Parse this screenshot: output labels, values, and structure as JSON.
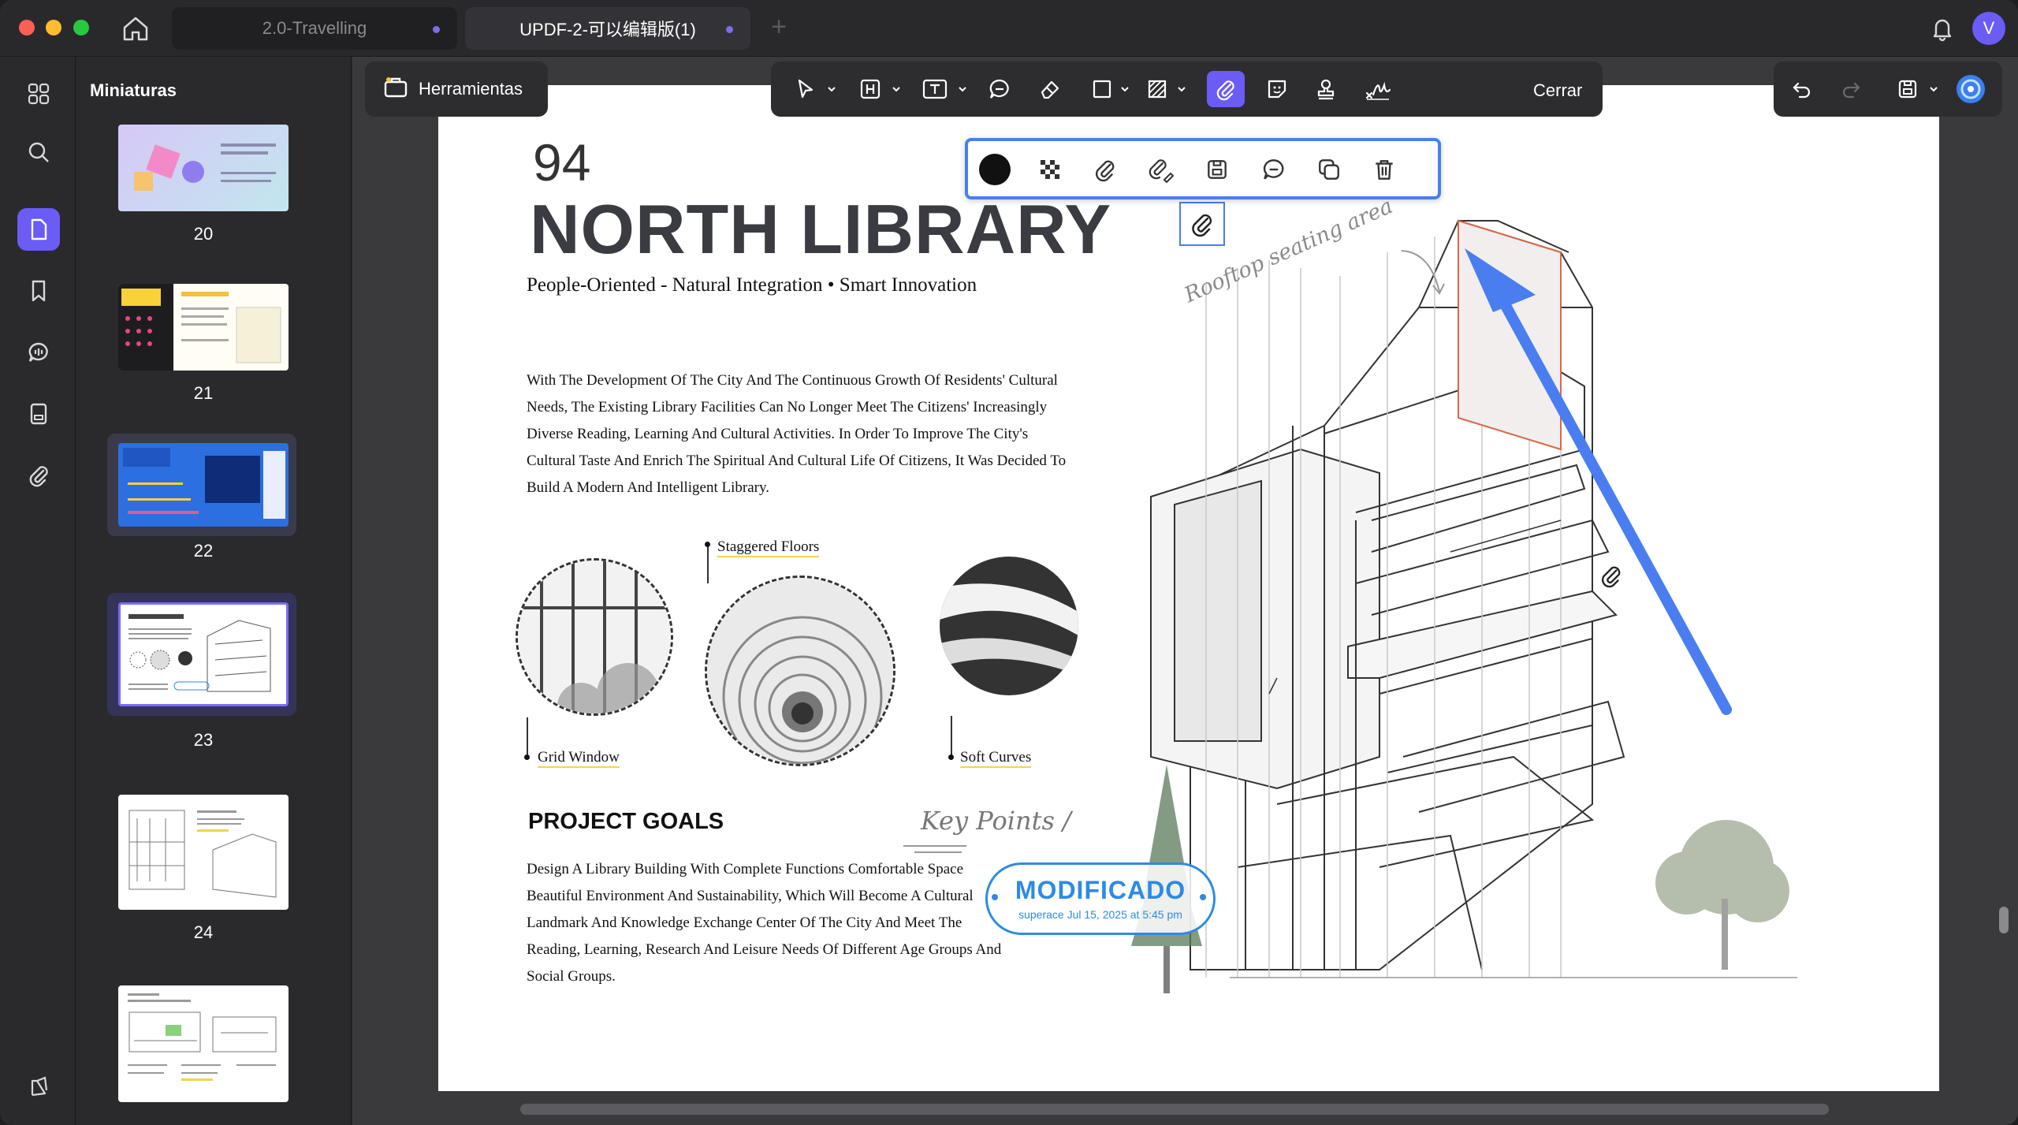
{
  "window": {
    "tabs": [
      {
        "label": "2.0-Travelling",
        "active": false
      },
      {
        "label": "UPDF-2-可以编辑版(1)",
        "active": true
      }
    ],
    "new_tab_symbol": "+",
    "avatar_letter": "V",
    "accent_color": "#6a5cf5"
  },
  "sidebar": {
    "title": "Miniaturas",
    "items": [
      "grid-icon",
      "search-icon",
      "page-icon",
      "bookmark-icon",
      "comment-icon",
      "form-icon",
      "attachment-icon"
    ],
    "active_item": "page-icon"
  },
  "thumbnails": [
    {
      "page": "20",
      "selected": false
    },
    {
      "page": "21",
      "selected": false
    },
    {
      "page": "22",
      "selected": false
    },
    {
      "page": "23",
      "selected": true
    },
    {
      "page": "24",
      "selected": false
    },
    {
      "page": "",
      "selected": false
    }
  ],
  "toolbar": {
    "tools_label": "Herramientas",
    "close_label": "Cerrar",
    "active_tool": "attachment-tool"
  },
  "annotation_toolbar": {
    "items": [
      "color-swatch",
      "opacity-icon",
      "attachment-icon",
      "attachment-edit-icon",
      "save-icon",
      "comment-icon",
      "duplicate-icon",
      "delete-icon"
    ]
  },
  "document": {
    "page_number": "94",
    "title": "NORTH LIBRARY",
    "subtitle": "People-Oriented - Natural Integration • Smart Innovation",
    "body": "With The Development Of The City And The Continuous Growth Of Residents' Cultural Needs, The Existing Library Facilities Can No Longer Meet The Citizens' Increasingly Diverse Reading, Learning And Cultural Activities. In Order To Improve The City's Cultural Taste And Enrich The Spiritual And Cultural Life Of Citizens, It Was Decided To Build A Modern And Intelligent Library.",
    "captions": {
      "grid_window": "Grid Window",
      "staggered_floors": "Staggered Floors",
      "soft_curves": "Soft Curves"
    },
    "rooftop_note": "Rooftop seating area",
    "goals_title": "PROJECT GOALS",
    "key_points": "Key Points /",
    "goals_body": "Design A Library Building With Complete Functions Comfortable Space Beautiful Environment And Sustainability, Which Will Become A Cultural Landmark And Knowledge Exchange Center Of The City And Meet The Reading, Learning, Research And Leisure Needs Of Different Age Groups And Social Groups.",
    "stamp": {
      "label": "MODIFICADO",
      "sub": "superace Jul 15, 2025 at 5:45 pm",
      "color": "#2e8ae6"
    },
    "arrow_color": "#4a7ef0"
  }
}
